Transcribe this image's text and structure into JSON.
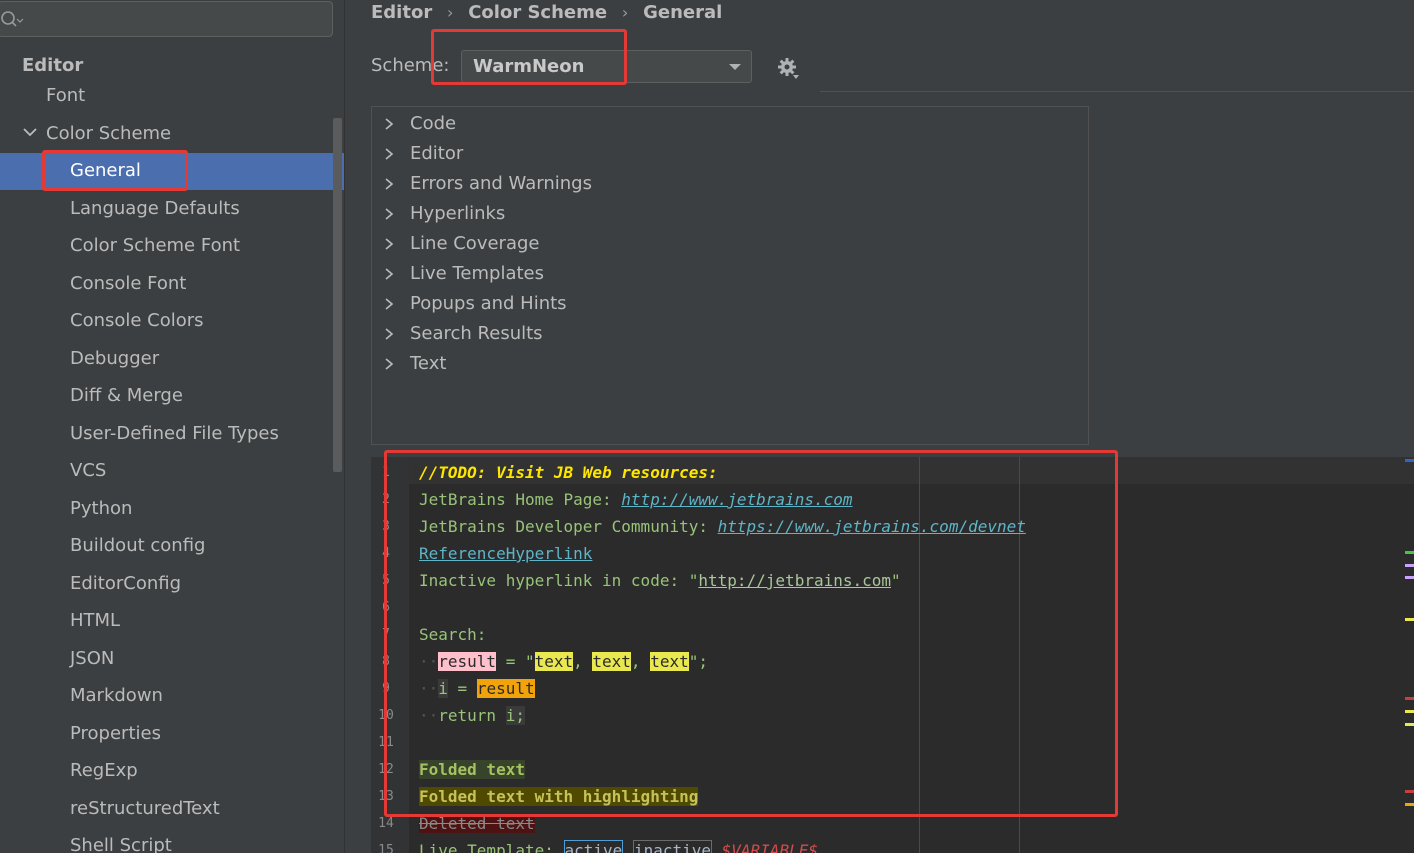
{
  "search": {
    "placeholder": ""
  },
  "sidebar": {
    "header": "Editor",
    "items": [
      {
        "label": "Font"
      },
      {
        "label": "Color Scheme"
      },
      {
        "label": "General"
      },
      {
        "label": "Language Defaults"
      },
      {
        "label": "Color Scheme Font"
      },
      {
        "label": "Console Font"
      },
      {
        "label": "Console Colors"
      },
      {
        "label": "Debugger"
      },
      {
        "label": "Diff & Merge"
      },
      {
        "label": "User-Defined File Types"
      },
      {
        "label": "VCS"
      },
      {
        "label": "Python"
      },
      {
        "label": "Buildout config"
      },
      {
        "label": "EditorConfig"
      },
      {
        "label": "HTML"
      },
      {
        "label": "JSON"
      },
      {
        "label": "Markdown"
      },
      {
        "label": "Properties"
      },
      {
        "label": "RegExp"
      },
      {
        "label": "reStructuredText"
      },
      {
        "label": "Shell Script"
      }
    ]
  },
  "breadcrumb": [
    "Editor",
    "Color Scheme",
    "General"
  ],
  "scheme": {
    "label": "Scheme:",
    "value": "WarmNeon"
  },
  "categories": [
    "Code",
    "Editor",
    "Errors and Warnings",
    "Hyperlinks",
    "Line Coverage",
    "Live Templates",
    "Popups and Hints",
    "Search Results",
    "Text"
  ],
  "preview": {
    "line_numbers": [
      "1",
      "2",
      "3",
      "4",
      "5",
      "6",
      "7",
      "8",
      "9",
      "10",
      "11",
      "12",
      "13",
      "14",
      "15"
    ],
    "l1": "//TODO: Visit JB Web resources:",
    "l2_prefix": "JetBrains Home Page: ",
    "l2_link": "http://www.jetbrains.com",
    "l3_prefix": "JetBrains Developer Community: ",
    "l3_link": "https://www.jetbrains.com/devnet",
    "l4_link": "ReferenceHyperlink",
    "l5_prefix": "Inactive hyperlink in code: \"",
    "l5_link": "http://jetbrains.com",
    "l5_suffix": "\"",
    "l7": "Search:",
    "l8_var": "result",
    "l8_eq": " = \"",
    "l8_t1": "text",
    "l8_sep": ", ",
    "l8_t2": "text",
    "l8_t3": "text",
    "l8_end": "\";",
    "l9_i": "i",
    "l9_eq": " = ",
    "l9_var": "result",
    "l10_kw": "return ",
    "l10_i": "i;",
    "l12": "Folded text",
    "l13": "Folded text with highlighting",
    "l14": "Deleted text",
    "l15_prefix": "Live Template: ",
    "l15_active": "active",
    "l15_inactive": "inactive",
    "l15_var": "$VARIABLE$"
  },
  "colors": {
    "selection": "#4b6eaf",
    "annotation": "#e53935",
    "stripe_marks": [
      "#2f65ca",
      "#3ec93e",
      "#c9a3ff",
      "#c9a3ff",
      "#e9e84e",
      "#c93e3e",
      "#e9e84e",
      "#e9e84e",
      "#c93e3e",
      "#f0a30a"
    ]
  }
}
